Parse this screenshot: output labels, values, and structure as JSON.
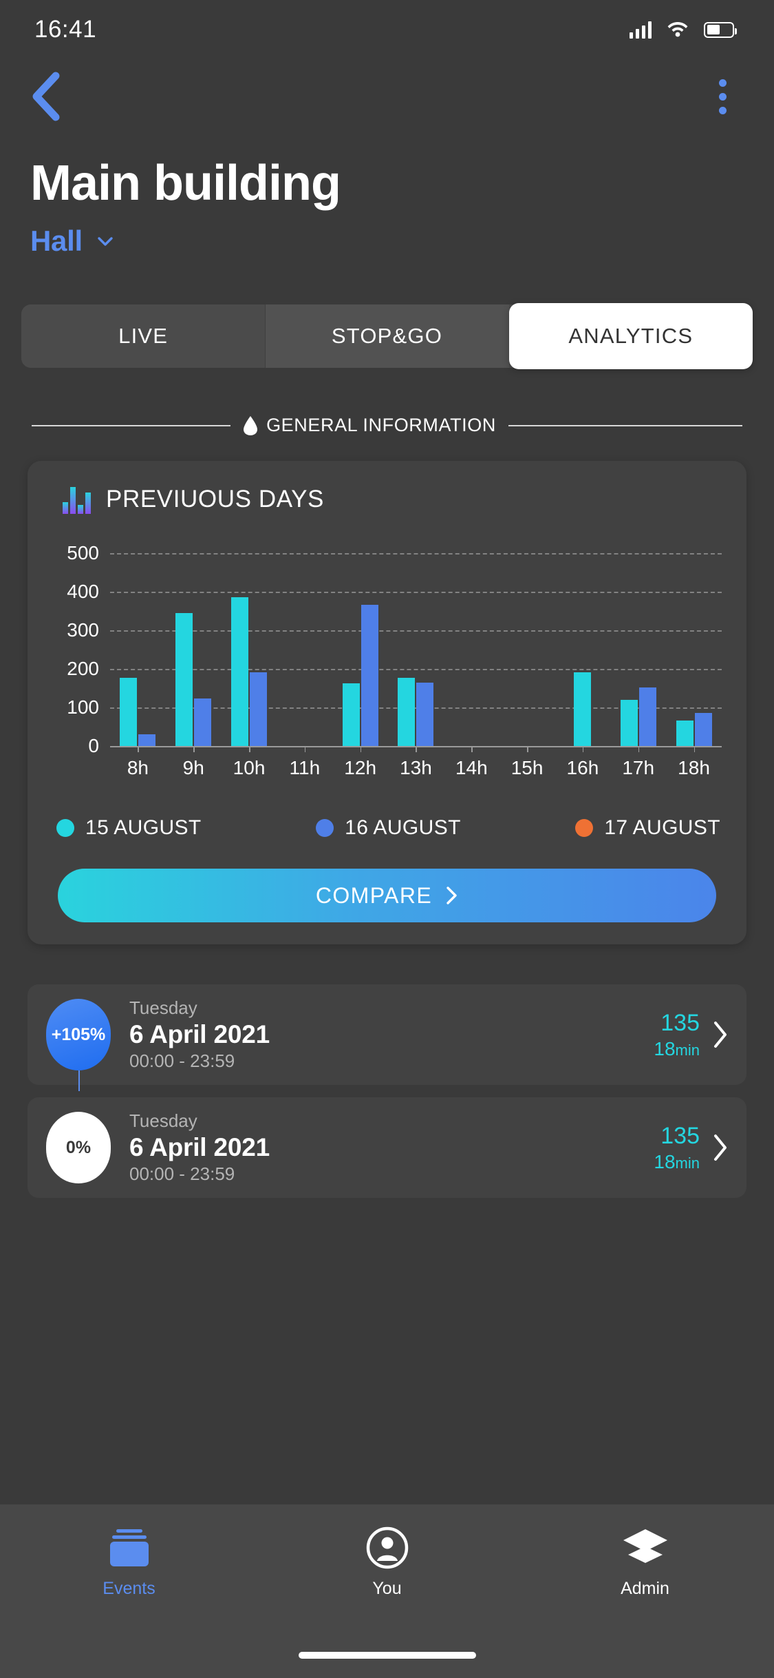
{
  "status_bar": {
    "time": "16:41",
    "signal_icon": "signal-bars-icon",
    "wifi_icon": "wifi-icon",
    "battery_icon": "battery-icon"
  },
  "nav": {
    "back_icon": "chevron-left-icon",
    "menu_icon": "kebab-menu-icon"
  },
  "header": {
    "title": "Main building",
    "zone": "Hall",
    "zone_chevron_icon": "chevron-down-icon"
  },
  "tabs": [
    {
      "label": "LIVE",
      "active": false
    },
    {
      "label": "STOP&GO",
      "active": false
    },
    {
      "label": "ANALYTICS",
      "active": true
    }
  ],
  "section": {
    "icon": "water-drop-icon",
    "label": "GENERAL INFORMATION"
  },
  "card": {
    "icon": "bar-chart-icon",
    "title": "PREVIUOUS DAYS",
    "compare_label": "COMPARE",
    "compare_chevron_icon": "chevron-right-icon"
  },
  "chart_data": {
    "type": "bar",
    "title": "PREVIUOUS DAYS",
    "xlabel": "",
    "ylabel": "",
    "ylim": [
      0,
      500
    ],
    "yticks": [
      0,
      100,
      200,
      300,
      400,
      500
    ],
    "ytick_labels": [
      "0",
      "100",
      "200",
      "300",
      "400",
      "500"
    ],
    "grid": true,
    "legend_position": "bottom",
    "categories": [
      "8h",
      "9h",
      "10h",
      "11h",
      "12h",
      "13h",
      "14h",
      "15h",
      "16h",
      "17h",
      "18h"
    ],
    "series": [
      {
        "name": "15 AUGUST",
        "color": "#24d6e0",
        "values": [
          177,
          344,
          386,
          0,
          163,
          176,
          0,
          0,
          191,
          119,
          66
        ]
      },
      {
        "name": "16 AUGUST",
        "color": "#4f7fe8",
        "values": [
          31,
          124,
          191,
          0,
          366,
          165,
          0,
          0,
          0,
          152,
          85
        ]
      },
      {
        "name": "17 AUGUST",
        "color": "#ef7134",
        "values": [
          0,
          0,
          0,
          0,
          0,
          0,
          0,
          0,
          0,
          0,
          0
        ]
      }
    ]
  },
  "events": [
    {
      "badge": "+105%",
      "badge_style": "blue",
      "day": "Tuesday",
      "date": "6 April 2021",
      "time_range": "00:00 - 23:59",
      "count": "135",
      "duration_value": "18",
      "duration_unit": "min",
      "chevron_icon": "chevron-right-icon"
    },
    {
      "badge": "0%",
      "badge_style": "white",
      "day": "Tuesday",
      "date": "6 April 2021",
      "time_range": "00:00 - 23:59",
      "count": "135",
      "duration_value": "18",
      "duration_unit": "min",
      "chevron_icon": "chevron-right-icon"
    }
  ],
  "bottom_nav": [
    {
      "label": "Events",
      "icon": "events-icon",
      "active": true
    },
    {
      "label": "You",
      "icon": "account-circle-icon",
      "active": false
    },
    {
      "label": "Admin",
      "icon": "layers-icon",
      "active": false
    }
  ],
  "colors": {
    "accent_blue": "#5b8def",
    "series_1": "#24d6e0",
    "series_2": "#4f7fe8",
    "series_3": "#ef7134",
    "background": "#3a3a3a",
    "card": "#414141"
  }
}
